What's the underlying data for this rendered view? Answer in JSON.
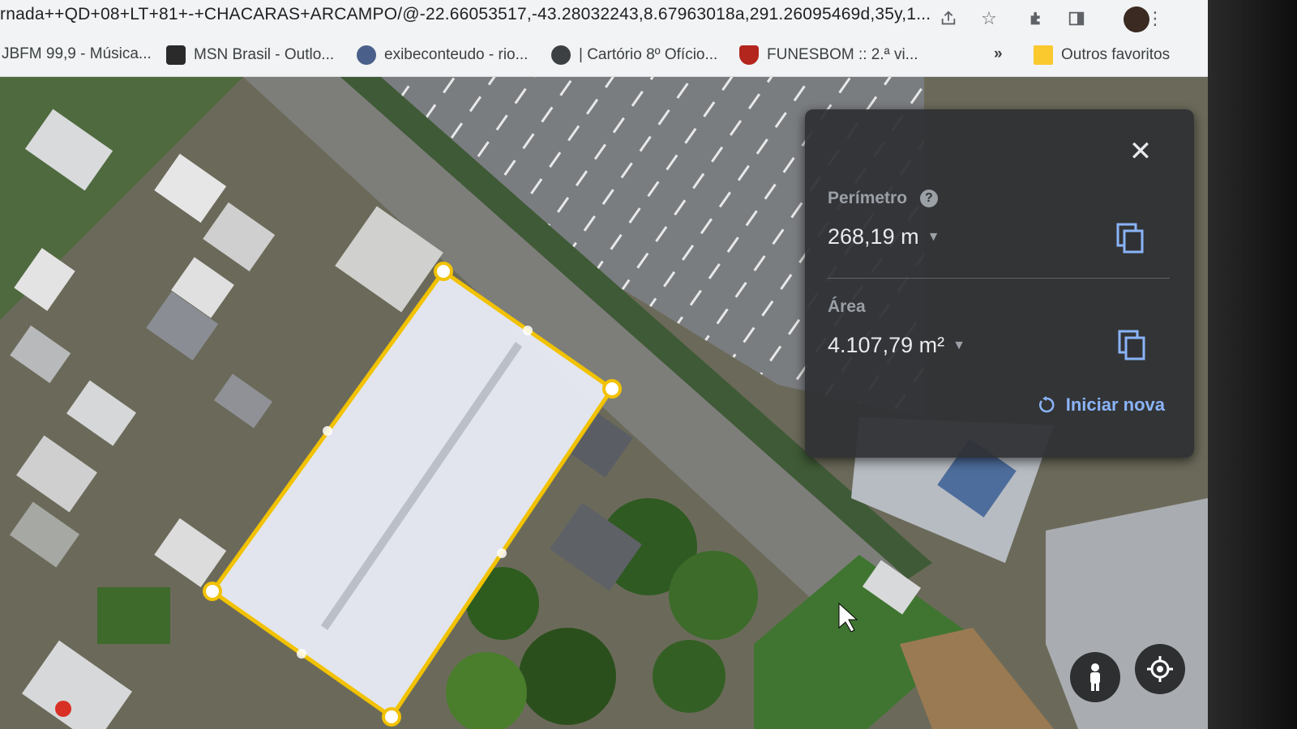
{
  "browser": {
    "url": "rnada++QD+08+LT+81+-+CHACARAS+ARCAMPO/@-22.66053517,-43.28032243,8.67963018a,291.26095469d,35y,1...",
    "icons": [
      "share-icon",
      "star-icon",
      "extensions-icon",
      "sidepanel-icon",
      "profile-avatar",
      "menu-icon"
    ]
  },
  "bookmarks": {
    "items": [
      {
        "label": "JBFM 99,9 - Música...",
        "icon": "none"
      },
      {
        "label": "MSN Brasil - Outlo...",
        "icon": "msn-icon",
        "color": "#2a2a2a"
      },
      {
        "label": "exibeconteudo - rio...",
        "icon": "rio-icon",
        "color": "#4a5f8a"
      },
      {
        "label": "| Cartório 8º Ofício...",
        "icon": "globe-icon",
        "color": "#3c4043"
      },
      {
        "label": "FUNESBOM :: 2.ª vi...",
        "icon": "shield-icon",
        "color": "#b3261e"
      }
    ],
    "more": "»",
    "other_folder": "Outros favoritos",
    "folder_color": "#f9c92e"
  },
  "measure": {
    "perimeter_label": "Perímetro",
    "perimeter_value": "268,19 m",
    "area_label": "Área",
    "area_value": "4.107,79 m²",
    "restart_label": "Iniciar nova",
    "help_glyph": "?",
    "close_glyph": "✕",
    "accent": "#8ab4f8"
  },
  "polygon": {
    "stroke_color": "#f2c200",
    "fill_color": "#e9ecf5"
  }
}
